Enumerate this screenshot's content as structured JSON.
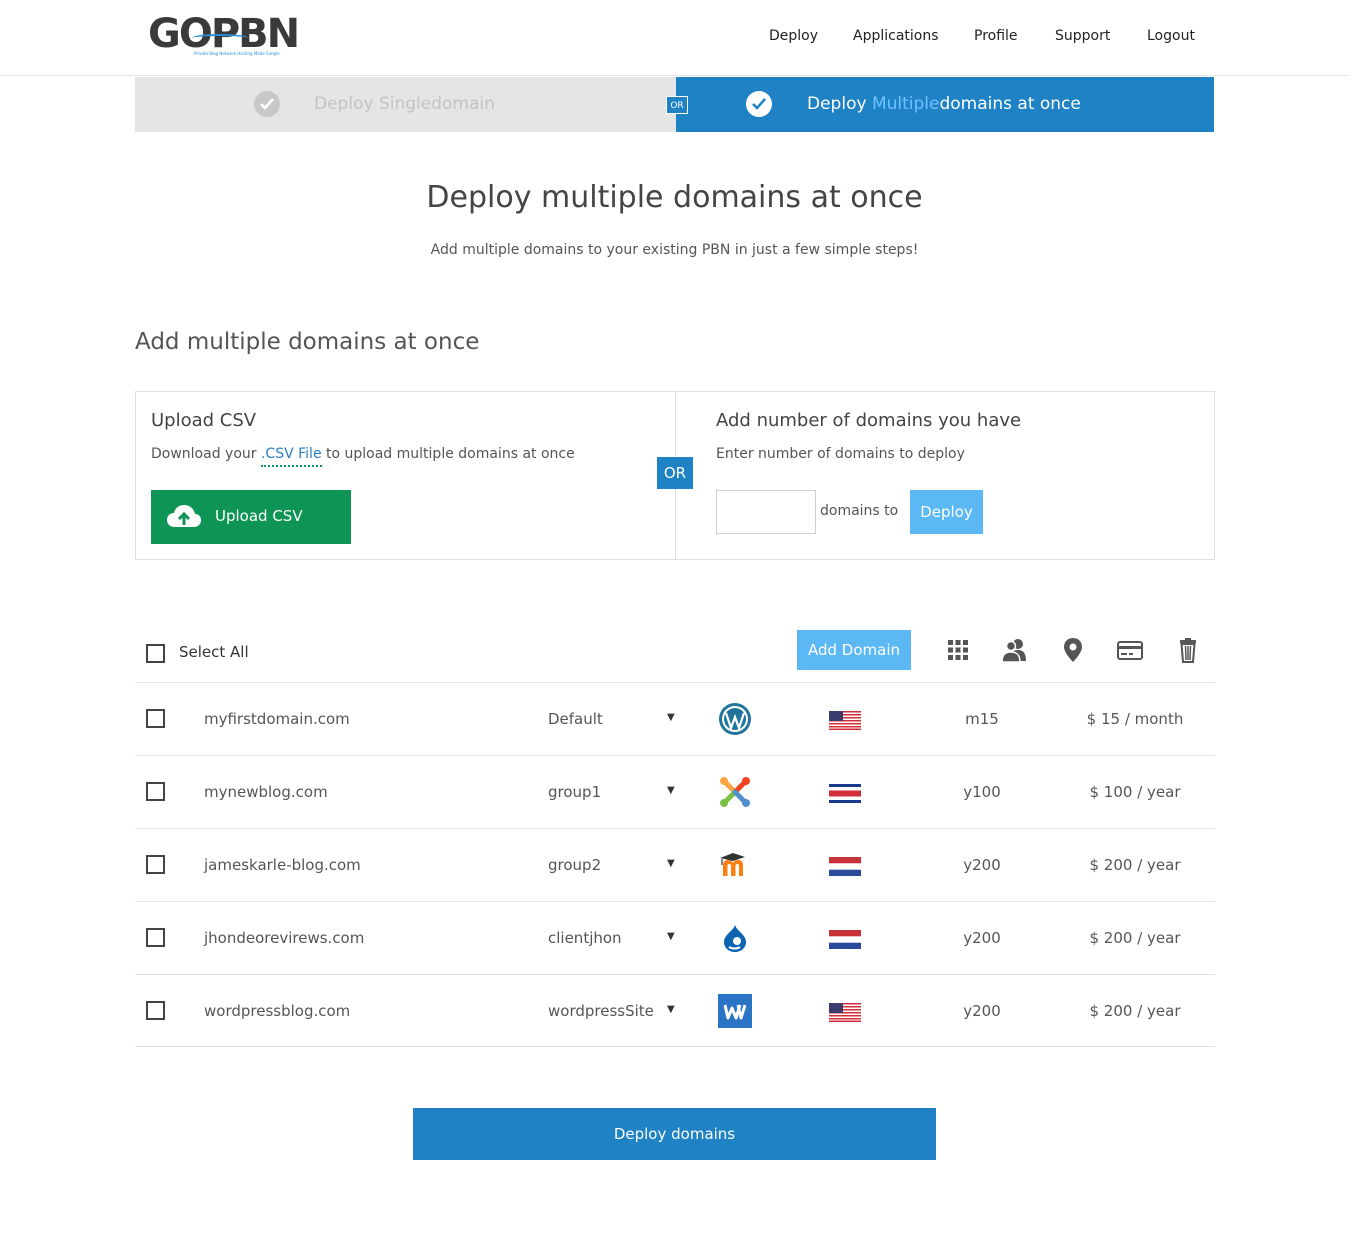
{
  "header": {
    "logo_text": "GOPBN",
    "logo_tagline": "Private Blog Network Hosting Made Simple",
    "nav": [
      "Deploy",
      "Applications",
      "Profile",
      "Support",
      "Logout"
    ]
  },
  "steps": {
    "single_label": "Deploy Singledomain",
    "or_label": "OR",
    "multi_label_prefix": "Deploy ",
    "multi_label_highlight": "Multiple",
    "multi_label_suffix": "domains at once"
  },
  "page": {
    "title": "Deploy multiple domains at once",
    "subtitle": "Add multiple domains to your existing PBN in just a few simple steps!",
    "section_title": "Add multiple domains at once"
  },
  "upload": {
    "title": "Upload CSV",
    "desc_prefix": "Download your ",
    "desc_link": ".CSV File",
    "desc_suffix": " to upload multiple domains at once",
    "button_label": "Upload CSV",
    "or_label": "OR"
  },
  "count": {
    "title": "Add number of domains you have",
    "desc": "Enter number of domains to deploy",
    "input_value": "",
    "mid_label": "domains to",
    "deploy_label": "Deploy"
  },
  "toolbar": {
    "select_all_label": "Select All",
    "add_domain_label": "Add Domain",
    "icons": [
      "grid-icon",
      "users-icon",
      "location-pin-icon",
      "credit-card-icon",
      "trash-icon"
    ]
  },
  "domains": [
    {
      "domain": "myfirstdomain.com",
      "group": "Default",
      "cms": "wordpress-icon",
      "flag": "us-flag-icon",
      "plan": "m15",
      "price": "$ 15 / month"
    },
    {
      "domain": "mynewblog.com",
      "group": "group1",
      "cms": "joomla-icon",
      "flag": "costa-rica-flag-icon",
      "plan": "y100",
      "price": "$ 100 / year"
    },
    {
      "domain": "jameskarle-blog.com",
      "group": "group2",
      "cms": "moodle-icon",
      "flag": "netherlands-flag-icon",
      "plan": "y200",
      "price": "$ 200 / year"
    },
    {
      "domain": "jhondeorevirews.com",
      "group": "clientjhon",
      "cms": "drupal-icon",
      "flag": "netherlands-flag-icon",
      "plan": "y200",
      "price": "$ 200 / year"
    },
    {
      "domain": "wordpressblog.com",
      "group": "wordpressSite",
      "cms": "weebly-icon",
      "flag": "us-flag-icon",
      "plan": "y200",
      "price": "$ 200 / year"
    }
  ],
  "colors": {
    "primary": "#1e82c4",
    "light_blue": "#5bb8f5",
    "green": "#0e9555"
  },
  "footer": {
    "deploy_domains_label": "Deploy domains"
  }
}
